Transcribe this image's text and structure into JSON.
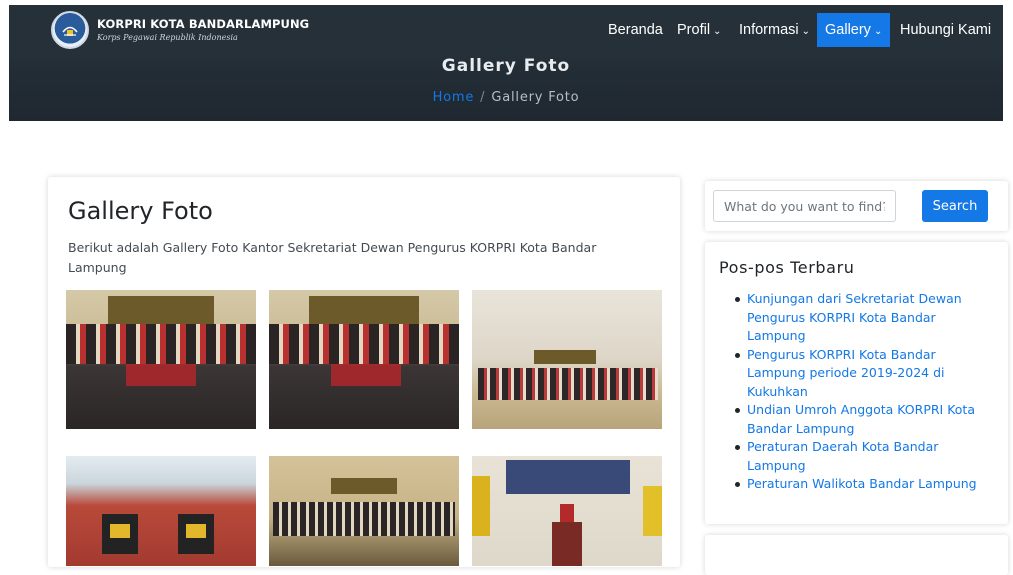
{
  "header": {
    "brand_title": "KORPRI KOTA BANDARLAMPUNG",
    "brand_subtitle": "Korps Pegawai Republik Indonesia",
    "nav": [
      {
        "label": "Beranda",
        "dropdown": false,
        "active": false
      },
      {
        "label": "Profil",
        "dropdown": true,
        "active": false
      },
      {
        "label": "Informasi",
        "dropdown": true,
        "active": false
      },
      {
        "label": "Gallery",
        "dropdown": true,
        "active": true
      },
      {
        "label": "Hubungi Kami",
        "dropdown": false,
        "active": false
      }
    ]
  },
  "hero": {
    "title": "Gallery Foto",
    "breadcrumb": {
      "home": "Home",
      "separator": "/",
      "current": "Gallery Foto"
    }
  },
  "main": {
    "title": "Gallery Foto",
    "description": "Berikut adalah Gallery Foto Kantor Sekretariat Dewan Pengurus KORPRI Kota Bandar Lampung"
  },
  "sidebar": {
    "search": {
      "placeholder": "What do you want to find?",
      "value": "",
      "button_label": "Search"
    },
    "recent_posts": {
      "title": "Pos-pos Terbaru",
      "items": [
        "Kunjungan dari Sekretariat Dewan Pengurus KORPRI Kota Bandar Lampung",
        "Pengurus KORPRI Kota Bandar Lampung periode 2019-2024 di Kukuhkan",
        "Undian Umroh Anggota KORPRI Kota Bandar Lampung",
        "Peraturan Daerah Kota Bandar Lampung",
        "Peraturan Walikota Bandar Lampung"
      ]
    }
  },
  "colors": {
    "accent": "#1478e6",
    "header_bg": "#263038",
    "text": "#212529"
  }
}
